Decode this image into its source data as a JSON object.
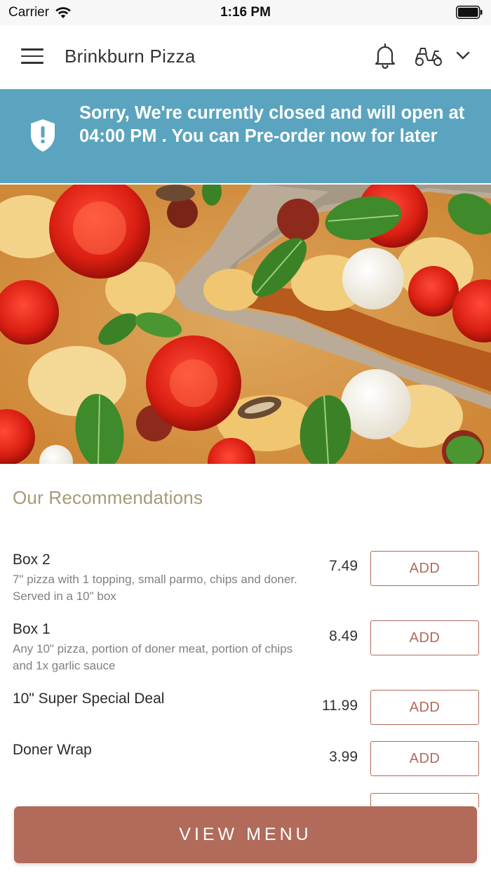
{
  "status_bar": {
    "carrier": "Carrier",
    "time": "1:16 PM"
  },
  "header": {
    "title": "Brinkburn Pizza",
    "icons": [
      "menu-icon",
      "bell-icon",
      "scooter-icon",
      "chevron-down-icon"
    ]
  },
  "banner": {
    "text": "Sorry, We're currently closed and will open at 04:00 PM . You can Pre-order now for later",
    "icon": "shield-alert-icon",
    "color": "#5ba4bf"
  },
  "recommendations": {
    "title": "Our Recommendations",
    "add_label": "ADD",
    "items": [
      {
        "name": "Box 2",
        "description": "7\" pizza with 1 topping, small parmo, chips and doner. Served in a 10\" box",
        "price": "7.49"
      },
      {
        "name": "Box 1",
        "description": "Any 10\" pizza, portion of doner meat, portion of chips and 1x garlic sauce",
        "price": "8.49"
      },
      {
        "name": "10\" Super Special Deal",
        "description": "",
        "price": "11.99"
      },
      {
        "name": "Doner Wrap",
        "description": "",
        "price": "3.99"
      }
    ]
  },
  "footer": {
    "view_menu_label": "VIEW MENU"
  },
  "colors": {
    "accent": "#b26a5a",
    "section_title": "#a89a78",
    "banner": "#5ba4bf"
  }
}
